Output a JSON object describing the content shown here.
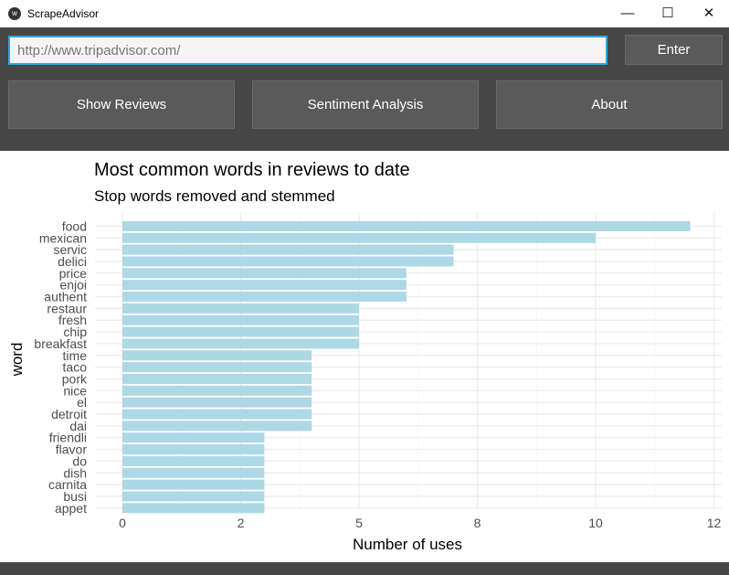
{
  "window": {
    "title": "ScrapeAdvisor",
    "minimize": "—",
    "maximize": "☐",
    "close": "✕"
  },
  "url_input": {
    "value": "http://www.tripadvisor.com/"
  },
  "buttons": {
    "enter": "Enter",
    "show_reviews": "Show Reviews",
    "sentiment": "Sentiment Analysis",
    "about": "About"
  },
  "chart_data": {
    "type": "bar",
    "orientation": "horizontal",
    "title": "Most common words in reviews to date",
    "subtitle": "Stop words removed and stemmed",
    "xlabel": "Number of uses",
    "ylabel": "word",
    "xlim": [
      0,
      12.5
    ],
    "xticks": [
      0,
      2.5,
      5,
      7.5,
      10,
      12.5
    ],
    "xtick_labels": [
      "0",
      "2",
      "5",
      "8",
      "10",
      "12"
    ],
    "bar_color": "#add8e6",
    "grid": true,
    "categories": [
      "food",
      "mexican",
      "servic",
      "delici",
      "price",
      "enjoi",
      "authent",
      "restaur",
      "fresh",
      "chip",
      "breakfast",
      "time",
      "taco",
      "pork",
      "nice",
      "el",
      "detroit",
      "dai",
      "friendli",
      "flavor",
      "do",
      "dish",
      "carnita",
      "busi",
      "appet"
    ],
    "values": [
      12,
      10,
      7,
      7,
      6,
      6,
      6,
      5,
      5,
      5,
      5,
      4,
      4,
      4,
      4,
      4,
      4,
      4,
      3,
      3,
      3,
      3,
      3,
      3,
      3
    ]
  }
}
